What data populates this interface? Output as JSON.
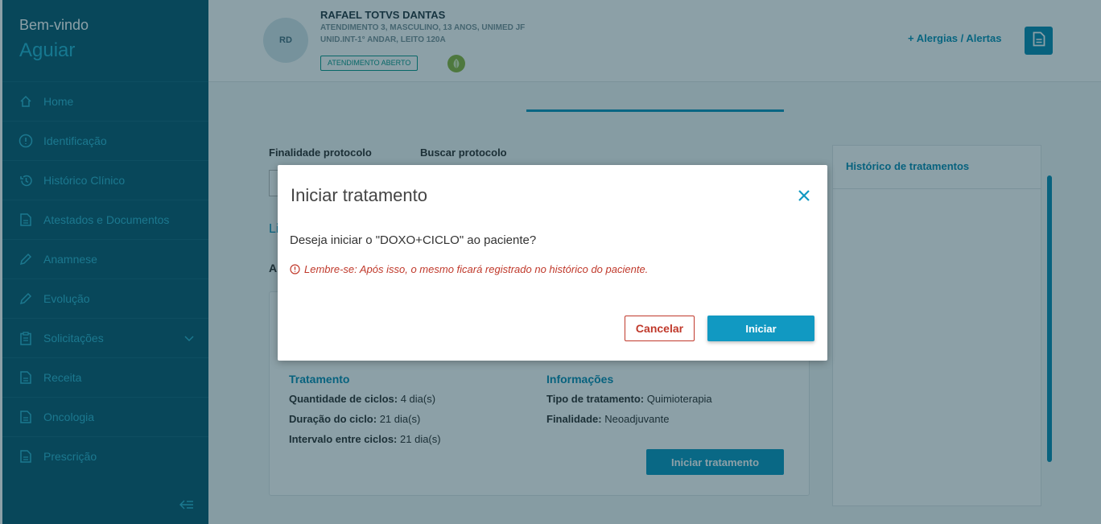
{
  "sidebar": {
    "welcome": "Bem-vindo",
    "username": "Aguiar",
    "items": [
      {
        "label": "Home",
        "icon": "home-icon"
      },
      {
        "label": "Identificação",
        "icon": "info-icon"
      },
      {
        "label": "Histórico Clínico",
        "icon": "history-icon"
      },
      {
        "label": "Atestados e Documentos",
        "icon": "document-icon"
      },
      {
        "label": "Anamnese",
        "icon": "pencil-icon"
      },
      {
        "label": "Evolução",
        "icon": "pencil-icon"
      },
      {
        "label": "Solicitações",
        "icon": "clipboard-icon"
      },
      {
        "label": "Receita",
        "icon": "document-icon"
      },
      {
        "label": "Oncologia",
        "icon": "document-icon"
      },
      {
        "label": "Prescrição",
        "icon": "document-icon"
      }
    ]
  },
  "patient": {
    "initials": "RD",
    "name": "RAFAEL TOTVS DANTAS",
    "info1": "ATENDIMENTO 3, MASCULINO, 13 ANOS, UNIMED JF",
    "info2": "UNID.INT-1° ANDAR, LEITO 120A",
    "status": "ATENDIMENTO ABERTO"
  },
  "header": {
    "allergies_label": "+ Alergias / Alertas"
  },
  "form": {
    "finalidade_label": "Finalidade protocolo",
    "buscar_label": "Buscar protocolo",
    "partial_l": "Li",
    "partial_a": "A"
  },
  "treatment": {
    "section_title": "Tratamento",
    "rows": [
      {
        "label": "Quantidade de ciclos:",
        "value": "4 dia(s)"
      },
      {
        "label": "Duração do ciclo:",
        "value": "21 dia(s)"
      },
      {
        "label": "Intervalo entre ciclos:",
        "value": "21 dia(s)"
      }
    ]
  },
  "info": {
    "section_title": "Informações",
    "rows": [
      {
        "label": "Tipo de tratamento:",
        "value": "Quimioterapia"
      },
      {
        "label": "Finalidade:",
        "value": "Neoadjuvante"
      }
    ]
  },
  "card": {
    "start_button": "Iniciar tratamento"
  },
  "history": {
    "title": "Histórico de tratamentos"
  },
  "modal": {
    "title": "Iniciar tratamento",
    "question": "Deseja iniciar o \"DOXO+CICLO\" ao paciente?",
    "warning": "Lembre-se: Após isso, o mesmo ficará registrado no histórico do paciente.",
    "cancel_label": "Cancelar",
    "confirm_label": "Iniciar"
  },
  "colors": {
    "sidebar_bg": "#0f5d73",
    "accent": "#1199c2",
    "danger": "#c0392b"
  }
}
